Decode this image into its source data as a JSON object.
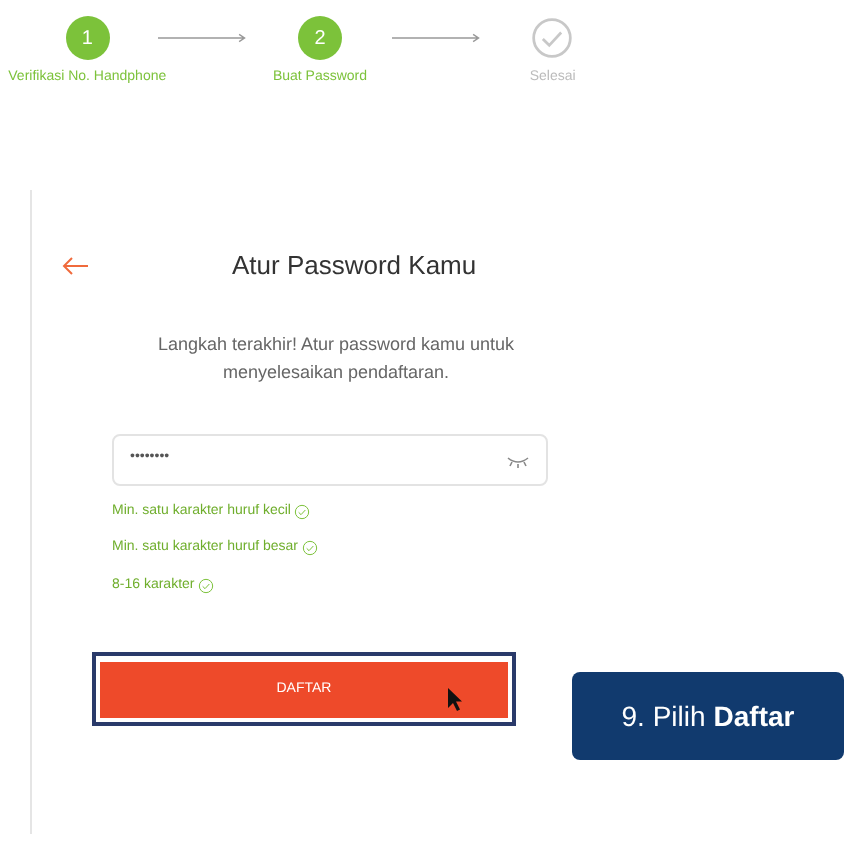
{
  "steps": [
    {
      "number": "1",
      "label": "Verifikasi No. Handphone",
      "done": true
    },
    {
      "number": "2",
      "label": "Buat Password",
      "done": true
    },
    {
      "label": "Selesai",
      "done": false
    }
  ],
  "card": {
    "title": "Atur Password Kamu",
    "description": "Langkah terakhir! Atur password kamu untuk menyelesaikan pendaftaran.",
    "password": {
      "value": "••••••••"
    },
    "requirements": [
      {
        "text": "Min. satu karakter huruf kecil",
        "met": true
      },
      {
        "text": "Min. satu karakter huruf besar",
        "met": true
      },
      {
        "text": "8-16 karakter",
        "met": true
      }
    ],
    "submit": "DAFTAR"
  },
  "callout": {
    "prefix": "9. Pilih ",
    "emphasis": "Daftar"
  }
}
